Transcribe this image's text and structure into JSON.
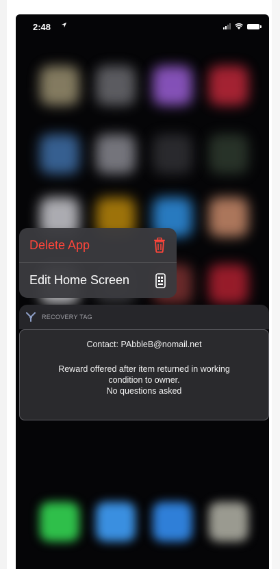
{
  "status_bar": {
    "time": "2:48",
    "location_icon": "location-arrow-icon",
    "signal_icon": "signal-bars-icon",
    "wifi_icon": "wifi-icon",
    "battery_icon": "battery-icon"
  },
  "context_menu": {
    "items": [
      {
        "label": "Delete App",
        "icon": "trash-icon",
        "color": "#ff453a"
      },
      {
        "label": "Edit Home Screen",
        "icon": "phone-grid-icon",
        "color": "#ffffff"
      }
    ]
  },
  "widget": {
    "header_label": "RECOVERY TAG",
    "header_icon": "recovery-tag-icon",
    "contact": "Contact: PAbbleB@nomail.net",
    "reward_line1": "Reward offered after item returned in working",
    "reward_line2": "condition to owner.",
    "reward_line3": "No questions asked"
  },
  "colors": {
    "background": "#050507",
    "menu_bg": "#3a3a3e",
    "destructive": "#ff453a",
    "card_bg": "#2a2a2d"
  },
  "blurred_icons": [
    "#9a9070",
    "#6b6b70",
    "#9b5fd6",
    "#c0283a",
    "#3f6fa8",
    "#888890",
    "#303034",
    "#2e3a2e",
    "#c9c9cf",
    "#b8860b",
    "#2f8fe0",
    "#c98a6a",
    "#d8d8dc",
    "#3a3a3e",
    "#7a3030",
    "#b02030"
  ],
  "dock_icons": [
    "#2fbf4a",
    "#3a8fe0",
    "#2f7fd8",
    "#9a9a90"
  ]
}
